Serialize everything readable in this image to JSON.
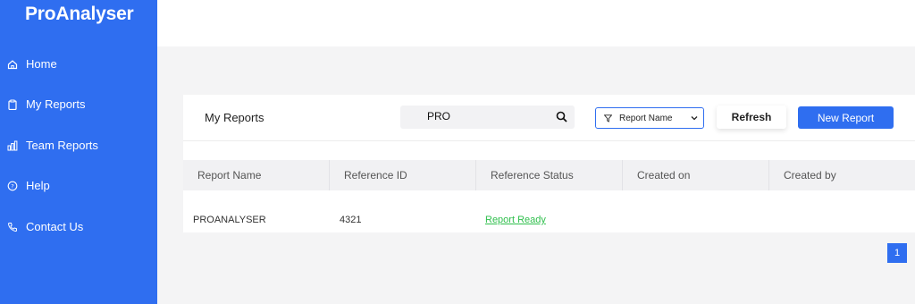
{
  "app": {
    "title": "ProAnalyser"
  },
  "sidebar": {
    "items": [
      {
        "label": "Home",
        "icon": "home-icon"
      },
      {
        "label": "My Reports",
        "icon": "clipboard-icon"
      },
      {
        "label": "Team Reports",
        "icon": "bar-chart-icon"
      },
      {
        "label": "Help",
        "icon": "help-icon"
      },
      {
        "label": "Contact Us",
        "icon": "phone-icon"
      }
    ]
  },
  "reports": {
    "title": "My Reports",
    "search": {
      "value": "PRO",
      "placeholder": ""
    },
    "filter": {
      "selected": "Report Name"
    },
    "refresh_label": "Refresh",
    "new_report_label": "New Report"
  },
  "table": {
    "headers": [
      "Report Name",
      "Reference ID",
      "Reference Status",
      "Created on",
      "Created by"
    ],
    "rows": [
      {
        "report_name": "PROANALYSER",
        "reference_id": "4321",
        "status": "Report Ready",
        "created_on": "",
        "created_by": ""
      }
    ]
  },
  "pagination": {
    "current": "1"
  },
  "colors": {
    "brand": "#2f6ef0",
    "status_ready": "#2fbf4c"
  }
}
